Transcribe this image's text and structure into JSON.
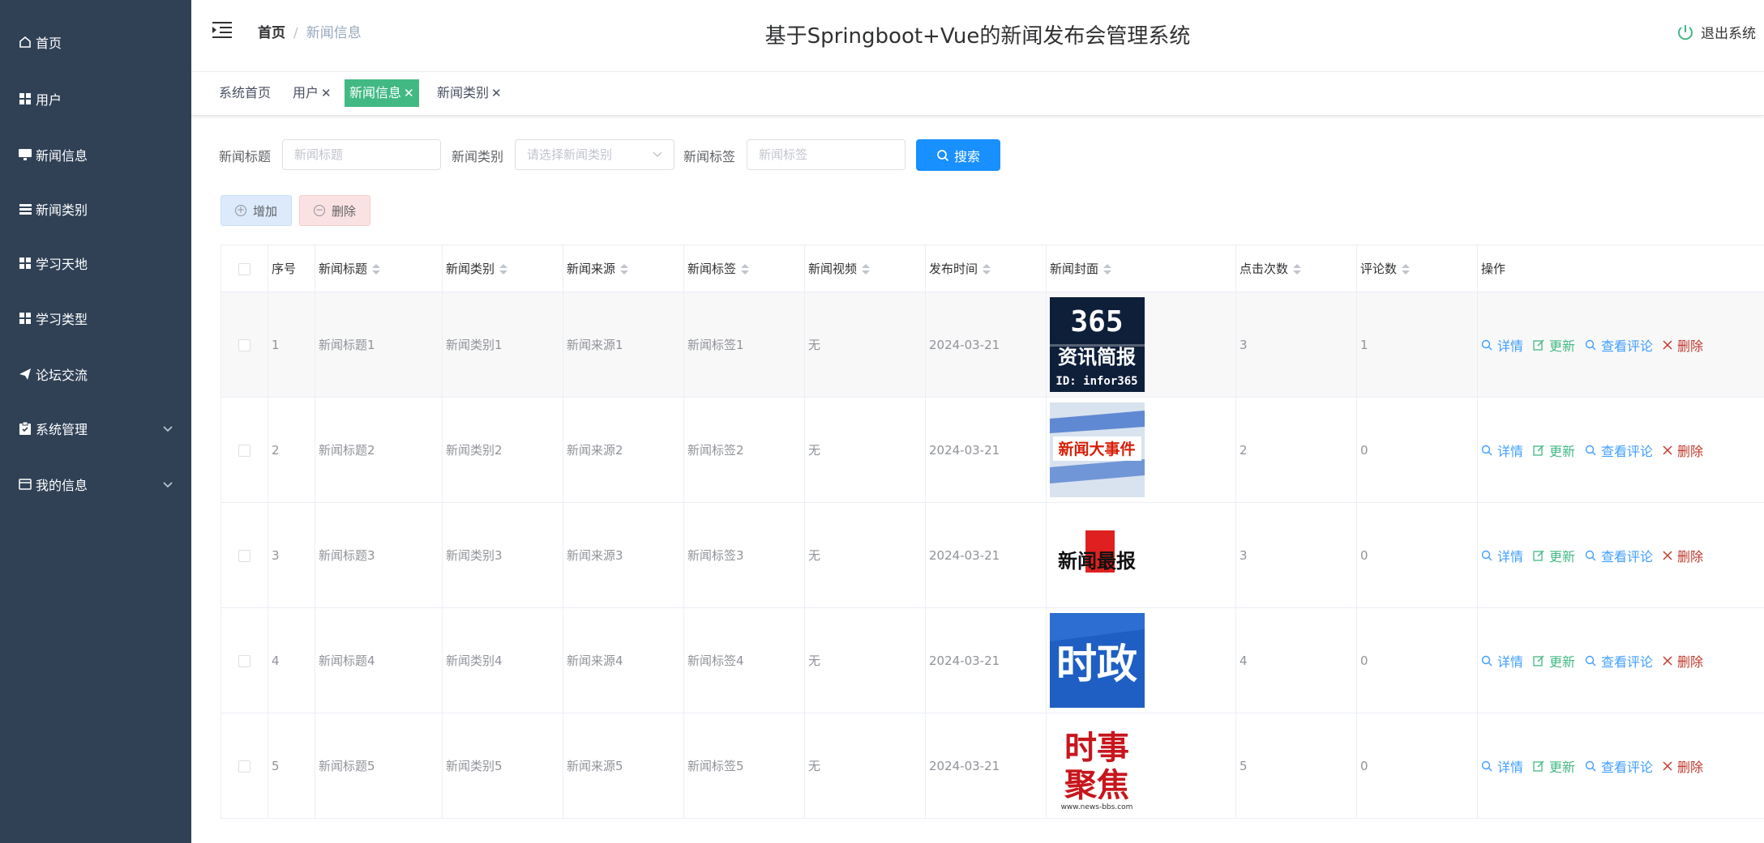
{
  "sidebar": {
    "items": [
      {
        "label": "首页",
        "icon": "home-icon"
      },
      {
        "label": "用户",
        "icon": "grid-icon"
      },
      {
        "label": "新闻信息",
        "icon": "monitor-icon"
      },
      {
        "label": "新闻类别",
        "icon": "list-icon"
      },
      {
        "label": "学习天地",
        "icon": "grid-icon"
      },
      {
        "label": "学习类型",
        "icon": "grid-icon"
      },
      {
        "label": "论坛交流",
        "icon": "send-icon"
      },
      {
        "label": "系统管理",
        "icon": "clipboard-icon",
        "expandable": true
      },
      {
        "label": "我的信息",
        "icon": "card-icon",
        "expandable": true
      }
    ]
  },
  "header": {
    "breadcrumb": {
      "home": "首页",
      "current": "新闻信息"
    },
    "title": "基于Springboot+Vue的新闻发布会管理系统",
    "logout_label": "退出系统"
  },
  "tags": [
    {
      "label": "系统首页",
      "closable": false,
      "active": false
    },
    {
      "label": "用户",
      "closable": true,
      "active": false
    },
    {
      "label": "新闻信息",
      "closable": true,
      "active": true
    },
    {
      "label": "新闻类别",
      "closable": true,
      "active": false
    }
  ],
  "search": {
    "title_label": "新闻标题",
    "title_placeholder": "新闻标题",
    "category_label": "新闻类别",
    "category_placeholder": "请选择新闻类别",
    "tag_label": "新闻标签",
    "tag_placeholder": "新闻标签",
    "button_label": "搜索"
  },
  "actions": {
    "add_label": "增加",
    "delete_label": "删除"
  },
  "table": {
    "columns": [
      "序号",
      "新闻标题",
      "新闻类别",
      "新闻来源",
      "新闻标签",
      "新闻视频",
      "发布时间",
      "新闻封面",
      "点击次数",
      "评论数",
      "操作"
    ],
    "op_labels": {
      "detail": "详情",
      "update": "更新",
      "comments": "查看评论",
      "delete": "删除"
    },
    "rows": [
      {
        "index": "1",
        "title": "新闻标题1",
        "category": "新闻类别1",
        "source": "新闻来源1",
        "tag": "新闻标签1",
        "video": "无",
        "date": "2024-03-21",
        "clicks": "3",
        "comments": "1",
        "cover": {
          "lines": [
            "365",
            "资讯简报",
            "ID: infor365"
          ],
          "bg": "#0e1f3a"
        }
      },
      {
        "index": "2",
        "title": "新闻标题2",
        "category": "新闻类别2",
        "source": "新闻来源2",
        "tag": "新闻标签2",
        "video": "无",
        "date": "2024-03-21",
        "clicks": "2",
        "comments": "0",
        "cover": {
          "lines": [
            "新闻大事件"
          ],
          "bg": "#d8e3ef"
        }
      },
      {
        "index": "3",
        "title": "新闻标题3",
        "category": "新闻类别3",
        "source": "新闻来源3",
        "tag": "新闻标签3",
        "video": "无",
        "date": "2024-03-21",
        "clicks": "3",
        "comments": "0",
        "cover": {
          "lines": [
            "新闻最报"
          ],
          "bg": "#ffffff"
        }
      },
      {
        "index": "4",
        "title": "新闻标题4",
        "category": "新闻类别4",
        "source": "新闻来源4",
        "tag": "新闻标签4",
        "video": "无",
        "date": "2024-03-21",
        "clicks": "4",
        "comments": "0",
        "cover": {
          "lines": [
            "时政"
          ],
          "bg": "#1f5fc4"
        }
      },
      {
        "index": "5",
        "title": "新闻标题5",
        "category": "新闻类别5",
        "source": "新闻来源5",
        "tag": "新闻标签5",
        "video": "无",
        "date": "2024-03-21",
        "clicks": "5",
        "comments": "0",
        "cover": {
          "lines": [
            "时事",
            "聚焦",
            "www.news-bbs.com"
          ],
          "bg": "#ffffff"
        }
      }
    ]
  },
  "colors": {
    "sidebar_bg": "#304156",
    "active_tag": "#42b983",
    "primary": "#1890ff",
    "danger": "#c0392b"
  }
}
